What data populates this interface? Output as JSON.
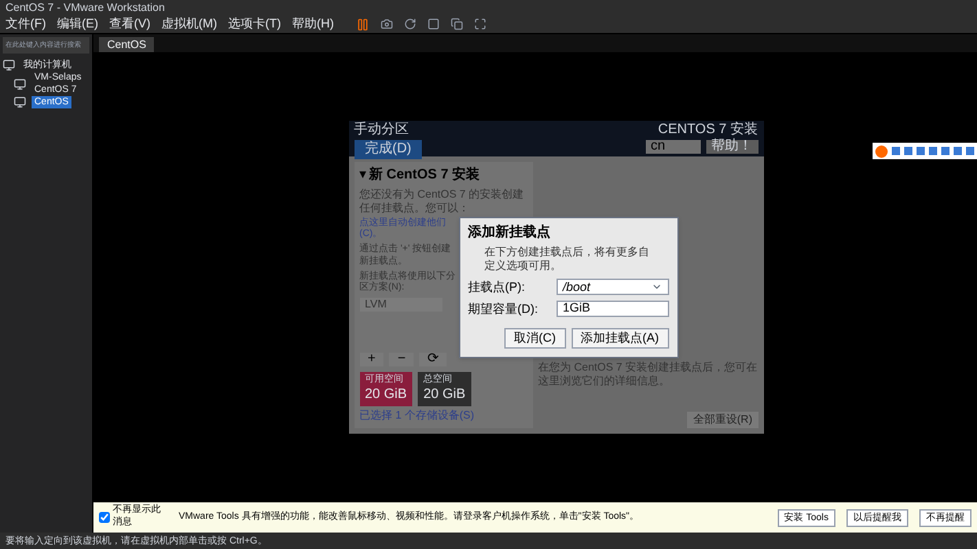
{
  "window": {
    "title": "CentOS 7 - VMware Workstation"
  },
  "menu": [
    "文件(F)",
    "编辑(E)",
    "查看(V)",
    "虚拟机(M)",
    "选项卡(T)",
    "帮助(H)"
  ],
  "sidebar": {
    "search": {
      "placeholder": "在此处键入内容进行搜索"
    },
    "tree": [
      {
        "label": "我的计算机",
        "selected": false,
        "children": [
          {
            "label": "VM-Selaps CentOS 7",
            "selected": false
          },
          {
            "label": "CentOS",
            "selected": true
          }
        ]
      }
    ]
  },
  "tabs": [
    {
      "label": "CentOS",
      "selected": true
    }
  ],
  "installer": {
    "title": "手动分区",
    "done": "完成(D)",
    "product": "CENTOS 7 安装",
    "keyboard": "cn",
    "help": "帮助！",
    "section_marker": "▾",
    "section": "新 CentOS 7 安装",
    "intro": "您还没有为 CentOS 7 的安装创建任何挂载点。您可以：",
    "auto_link": "点这里自动创建他们(C)。",
    "plus_hint": "通过点击 '+' 按钮创建新挂载点。",
    "scheme_label": "新挂载点将使用以下分区方案(N):",
    "scheme": "LVM",
    "tools": [
      "+",
      "−",
      "⟳"
    ],
    "space": [
      {
        "label": "可用空间",
        "value": "20 GiB",
        "kind": "available"
      },
      {
        "label": "总空间",
        "value": "20 GiB",
        "kind": "total"
      }
    ],
    "storage_link": "已选择 1 个存储设备(S)",
    "details_hint": "在您为 CentOS 7 安装创建挂载点后，您可在这里浏览它们的详细信息。",
    "reset": "全部重设(R)"
  },
  "dialog": {
    "title": "添加新挂载点",
    "hint": "在下方创建挂载点后，将有更多自定义选项可用。",
    "mount_label": "挂载点(P):",
    "mount_value": "/boot",
    "capacity_label": "期望容量(D):",
    "capacity_value": "1GiB",
    "cancel": "取消(C)",
    "add": "添加挂载点(A)"
  },
  "notice": {
    "checkbox": {
      "label": "不再显示此消息",
      "checked": true
    },
    "text": "VMware Tools 具有增强的功能，能改善鼠标移动、视频和性能。请登录客户机操作系统，单击\"安装 Tools\"。",
    "buttons": [
      "安装 Tools",
      "以后提醒我",
      "不再提醒"
    ]
  },
  "status_bar": "要将输入定向到该虚拟机，请在虚拟机内部单击或按 Ctrl+G。"
}
